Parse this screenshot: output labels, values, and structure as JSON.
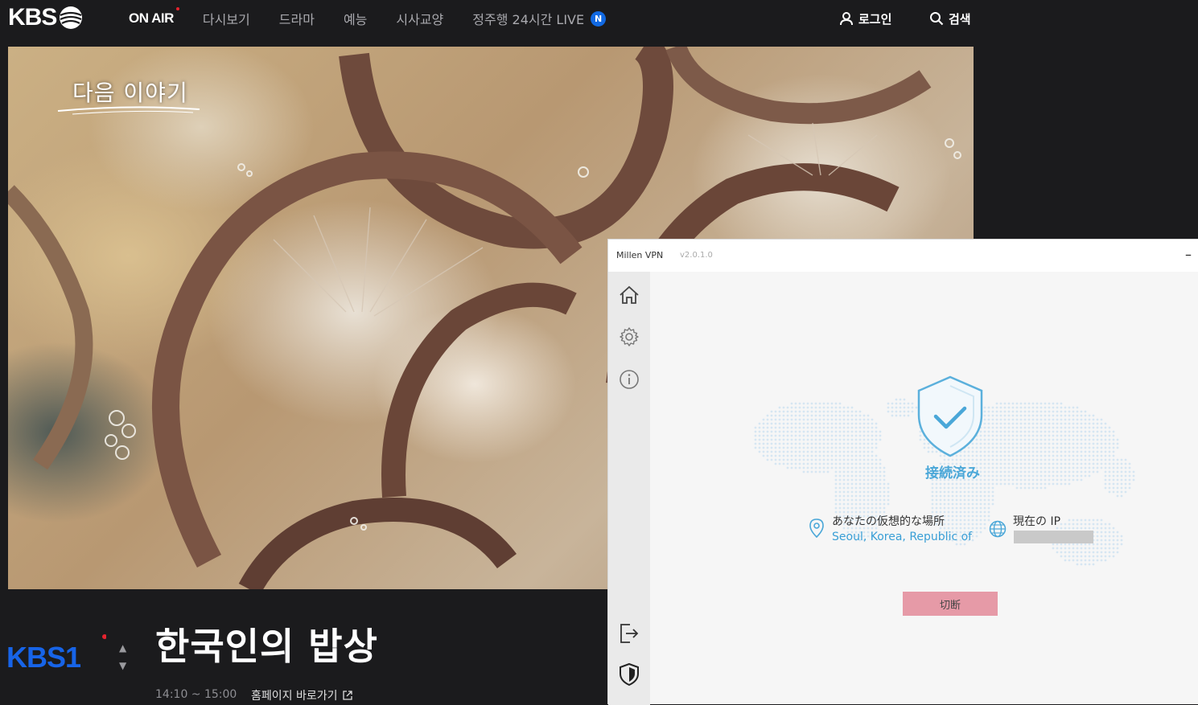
{
  "header": {
    "logo": "KBS",
    "nav": [
      {
        "label": "ON AIR"
      },
      {
        "label": "다시보기"
      },
      {
        "label": "드라마"
      },
      {
        "label": "예능"
      },
      {
        "label": "시사교양"
      },
      {
        "label": "정주행 24시간 LIVE",
        "badge": "N"
      }
    ],
    "login": "로그인",
    "search": "검색"
  },
  "video": {
    "caption": "다음 이야기"
  },
  "program": {
    "channel_logo": "KBS1",
    "title": "한국인의 밥상",
    "time": "14:10 ~ 15:00",
    "homepage_link": "홈페이지 바로가기"
  },
  "vpn": {
    "app_name": "Millen VPN",
    "version": "v2.0.1.0",
    "minimize": "–",
    "status": "接続済み",
    "location_label": "あなたの仮想的な場所",
    "location_value": "Seoul, Korea, Republic of",
    "ip_label": "現在の IP",
    "disconnect_label": "切断",
    "colors": {
      "accent": "#4aa7d8",
      "disconnect": "#e69aa7"
    },
    "icons": [
      "home-icon",
      "settings-icon",
      "info-icon",
      "logout-icon",
      "shield-icon"
    ]
  },
  "colors": {
    "header_bg": "#1b1b1d",
    "badge": "#1169e2",
    "kbs_blue": "#1764e8"
  }
}
